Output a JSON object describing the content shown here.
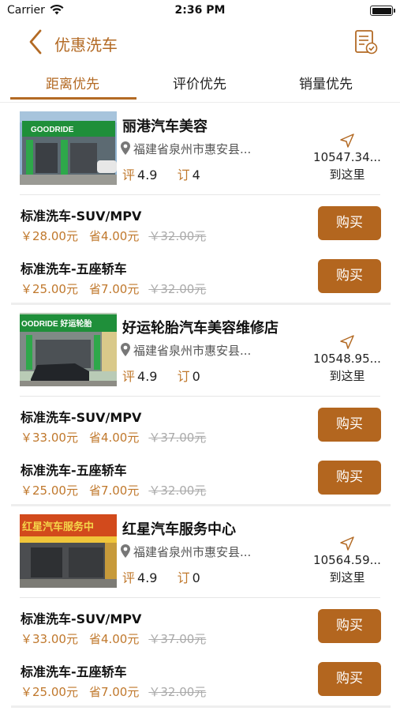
{
  "status_bar": {
    "carrier": "Carrier",
    "time": "2:36 PM"
  },
  "nav": {
    "title": "优惠洗车",
    "back_icon": "chevron-left-icon",
    "right_icon": "bill-check-icon"
  },
  "tabs": [
    {
      "label": "距离优先",
      "active": true
    },
    {
      "label": "评价优先",
      "active": false
    },
    {
      "label": "销量优先",
      "active": false
    }
  ],
  "colors": {
    "accent": "#b36a24",
    "button": "#b3661f",
    "price": "#c0782c"
  },
  "shops": [
    {
      "name": "丽港汽车美容",
      "address": "福建省泉州市惠安县...",
      "rating_label": "评",
      "rating": "4.9",
      "orders_label": "订",
      "orders": "4",
      "distance": "10547.34...",
      "go_label": "到这里",
      "packages": [
        {
          "name": "标准洗车-SUV/MPV",
          "price": "￥28.00元",
          "save": "省4.00元",
          "original": "￥32.00元",
          "buy_label": "购买"
        },
        {
          "name": "标准洗车-五座轿车",
          "price": "￥25.00元",
          "save": "省7.00元",
          "original": "￥32.00元",
          "buy_label": "购买"
        }
      ]
    },
    {
      "name": "好运轮胎汽车美容维修店",
      "address": "福建省泉州市惠安县...",
      "rating_label": "评",
      "rating": "4.9",
      "orders_label": "订",
      "orders": "0",
      "distance": "10548.95...",
      "go_label": "到这里",
      "packages": [
        {
          "name": "标准洗车-SUV/MPV",
          "price": "￥33.00元",
          "save": "省4.00元",
          "original": "￥37.00元",
          "buy_label": "购买"
        },
        {
          "name": "标准洗车-五座轿车",
          "price": "￥25.00元",
          "save": "省7.00元",
          "original": "￥32.00元",
          "buy_label": "购买"
        }
      ]
    },
    {
      "name": "红星汽车服务中心",
      "address": "福建省泉州市惠安县...",
      "rating_label": "评",
      "rating": "4.9",
      "orders_label": "订",
      "orders": "0",
      "distance": "10564.59...",
      "go_label": "到这里",
      "packages": [
        {
          "name": "标准洗车-SUV/MPV",
          "price": "￥33.00元",
          "save": "省4.00元",
          "original": "￥37.00元",
          "buy_label": "购买"
        },
        {
          "name": "标准洗车-五座轿车",
          "price": "￥25.00元",
          "save": "省7.00元",
          "original": "￥32.00元",
          "buy_label": "购买"
        }
      ]
    }
  ],
  "shop_photos": {
    "shop1_sign": "GOODRIDE",
    "shop2_sign": "OODRIDE 好运轮胎",
    "shop3_sign": "红星汽车服务中"
  }
}
